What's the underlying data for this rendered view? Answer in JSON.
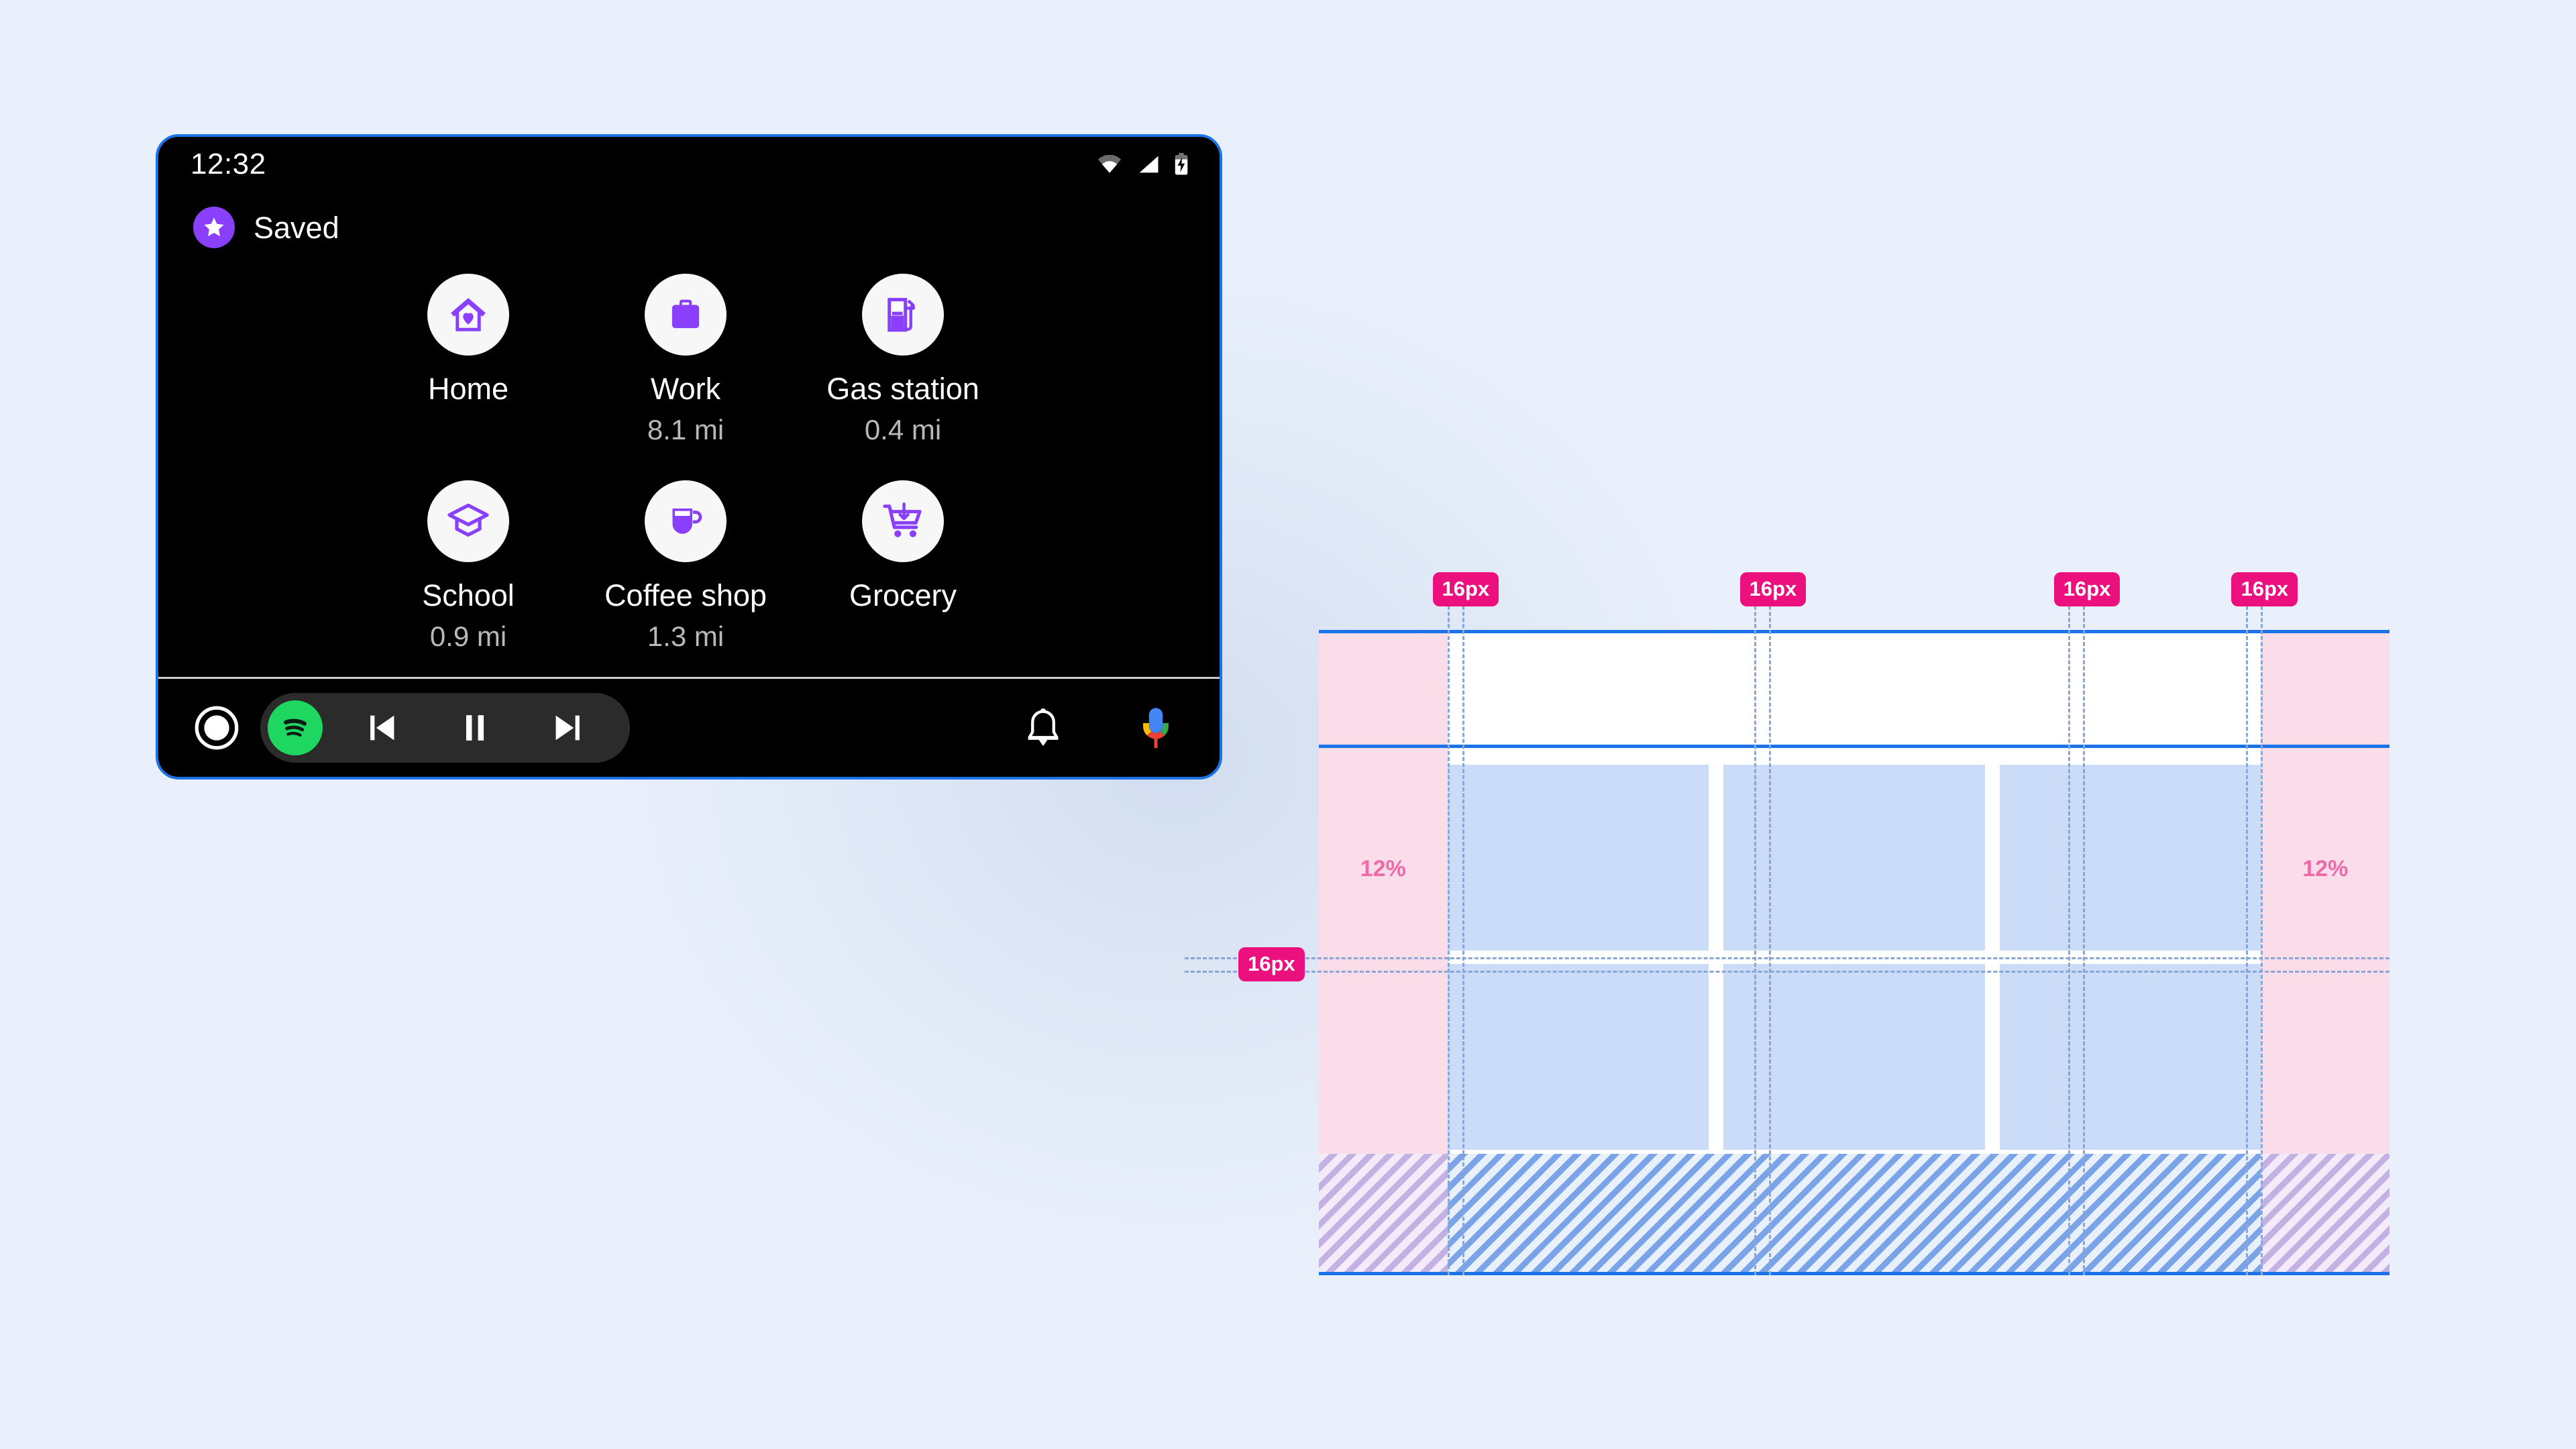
{
  "device": {
    "status_bar": {
      "time": "12:32",
      "icons": [
        "wifi-icon",
        "cell-signal-icon",
        "battery-charging-icon"
      ]
    },
    "header": {
      "badge_icon": "star-icon",
      "title": "Saved"
    },
    "shortcuts": [
      {
        "icon": "home-heart-icon",
        "label": "Home",
        "distance": ""
      },
      {
        "icon": "briefcase-icon",
        "label": "Work",
        "distance": "8.1 mi"
      },
      {
        "icon": "gas-pump-icon",
        "label": "Gas station",
        "distance": "0.4 mi"
      },
      {
        "icon": "graduation-cap-icon",
        "label": "School",
        "distance": "0.9 mi"
      },
      {
        "icon": "coffee-cup-icon",
        "label": "Coffee shop",
        "distance": "1.3 mi"
      },
      {
        "icon": "shopping-cart-icon",
        "label": "Grocery",
        "distance": ""
      }
    ],
    "navbar": {
      "home_icon": "home-circle-icon",
      "media_app_icon": "spotify-icon",
      "previous_icon": "skip-previous-icon",
      "pause_icon": "pause-icon",
      "next_icon": "skip-next-icon",
      "notifications_icon": "bell-icon",
      "assistant_icon": "google-assistant-mic-icon"
    }
  },
  "spec": {
    "margin_left_label": "12%",
    "margin_right_label": "12%",
    "gutter_badges": [
      "16px",
      "16px",
      "16px",
      "16px"
    ],
    "row_gutter_badge": "16px",
    "colors": {
      "accent_blue": "#1a73e8",
      "badge_pink": "#ec0f7e",
      "margin_pink": "#fbdde9",
      "cell_blue": "#cadcf8",
      "guide_blue": "#8aa6d6",
      "purple": "#8a3ffc",
      "spotify_green": "#1ed760",
      "canvas": "#e9f0fb"
    }
  }
}
